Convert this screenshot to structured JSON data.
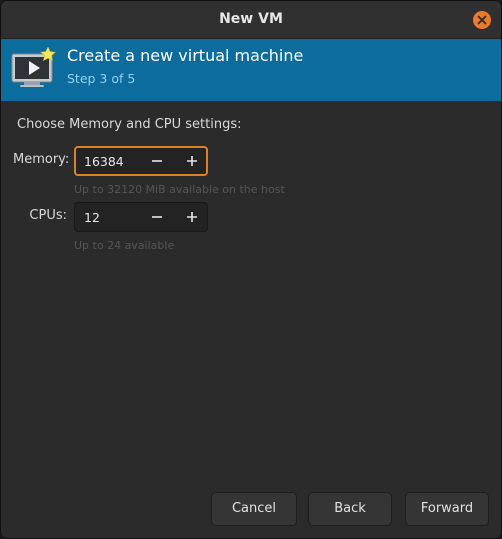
{
  "window": {
    "title": "New VM"
  },
  "banner": {
    "title": "Create a new virtual machine",
    "step": "Step 3 of 5"
  },
  "form": {
    "heading": "Choose Memory and CPU settings:",
    "memory": {
      "label": "Memory:",
      "value": "16384",
      "hint": "Up to 32120 MiB available on the host"
    },
    "cpus": {
      "label": "CPUs:",
      "value": "12",
      "hint": "Up to 24 available"
    }
  },
  "buttons": {
    "cancel": "Cancel",
    "back": "Back",
    "forward": "Forward"
  },
  "colors": {
    "accent": "#d9822b",
    "banner": "#0c6c9e",
    "close": "#ec7a2c"
  },
  "icons": [
    "close-icon",
    "virtual-machine-icon",
    "minus-icon",
    "plus-icon"
  ]
}
